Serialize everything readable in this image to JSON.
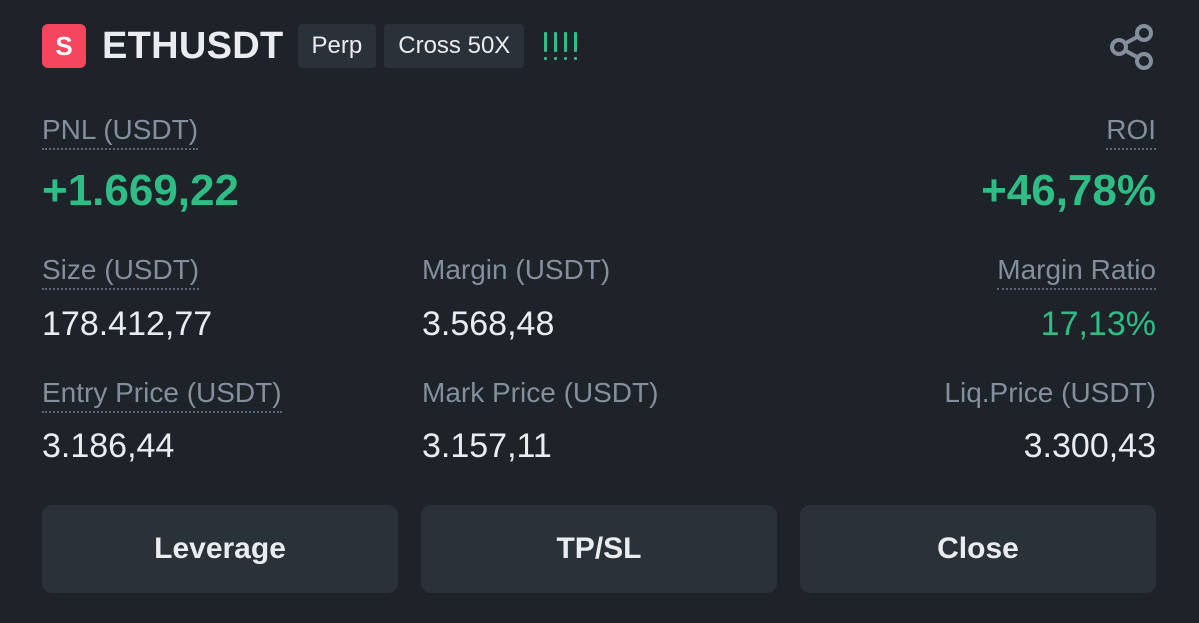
{
  "header": {
    "side_badge": "S",
    "symbol": "ETHUSDT",
    "contract_type": "Perp",
    "margin_mode": "Cross 50X",
    "adl_indicator": "!!!!",
    "share_icon": "share-icon"
  },
  "pnl": {
    "label": "PNL (USDT)",
    "value": "+1.669,22"
  },
  "roi": {
    "label": "ROI",
    "value": "+46,78%"
  },
  "size": {
    "label": "Size (USDT)",
    "value": "178.412,77"
  },
  "margin": {
    "label": "Margin (USDT)",
    "value": "3.568,48"
  },
  "margin_ratio": {
    "label": "Margin Ratio",
    "value": "17,13%"
  },
  "entry_price": {
    "label": "Entry Price (USDT)",
    "value": "3.186,44"
  },
  "mark_price": {
    "label": "Mark Price (USDT)",
    "value": "3.157,11"
  },
  "liq_price": {
    "label": "Liq.Price (USDT)",
    "value": "3.300,43"
  },
  "actions": {
    "leverage": "Leverage",
    "tpsl": "TP/SL",
    "close": "Close"
  },
  "colors": {
    "background": "#1e2329",
    "positive": "#2ebd85",
    "short_badge": "#f6465d",
    "button": "#2b3139",
    "muted_text": "#848e9c"
  }
}
